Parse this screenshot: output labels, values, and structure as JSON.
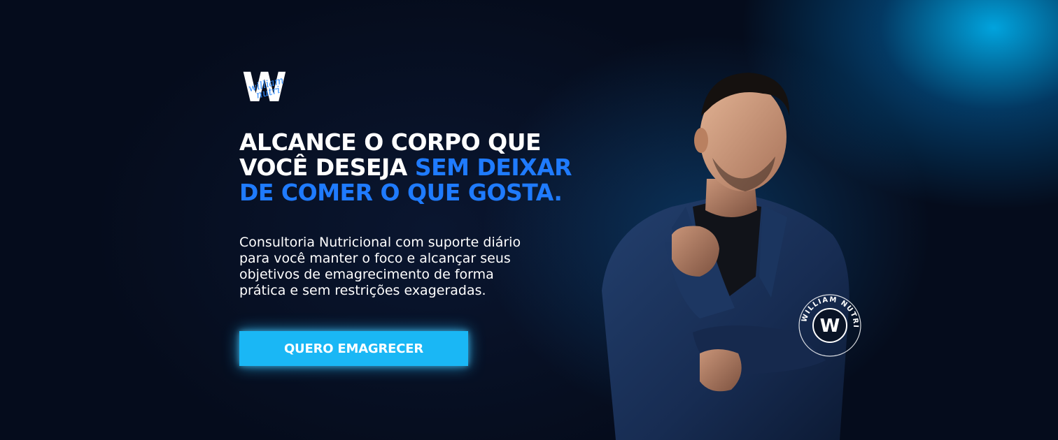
{
  "brand": {
    "logo_letter": "W",
    "logo_script": "william nutri"
  },
  "headline": {
    "line1": "ALCANCE O CORPO QUE",
    "line2_white": "VOCÊ DESEJA ",
    "line2_accent": "SEM DEIXAR",
    "line3_accent": "DE COMER O QUE GOSTA."
  },
  "body": {
    "line1": "Consultoria Nutricional com suporte diário",
    "line2": "para você manter o foco e alcançar seus",
    "line3": "objetivos de emagrecimento de forma",
    "line4": "prática e sem restrições exageradas."
  },
  "cta": {
    "label": "QUERO EMAGRECER"
  },
  "badge": {
    "letter": "W",
    "ring_text": "WILLIAM NUTRI"
  },
  "colors": {
    "background": "#050c1c",
    "accent_blue": "#1f7bff",
    "cta_cyan": "#1ab7f5",
    "glow_cyan": "#00beff"
  }
}
